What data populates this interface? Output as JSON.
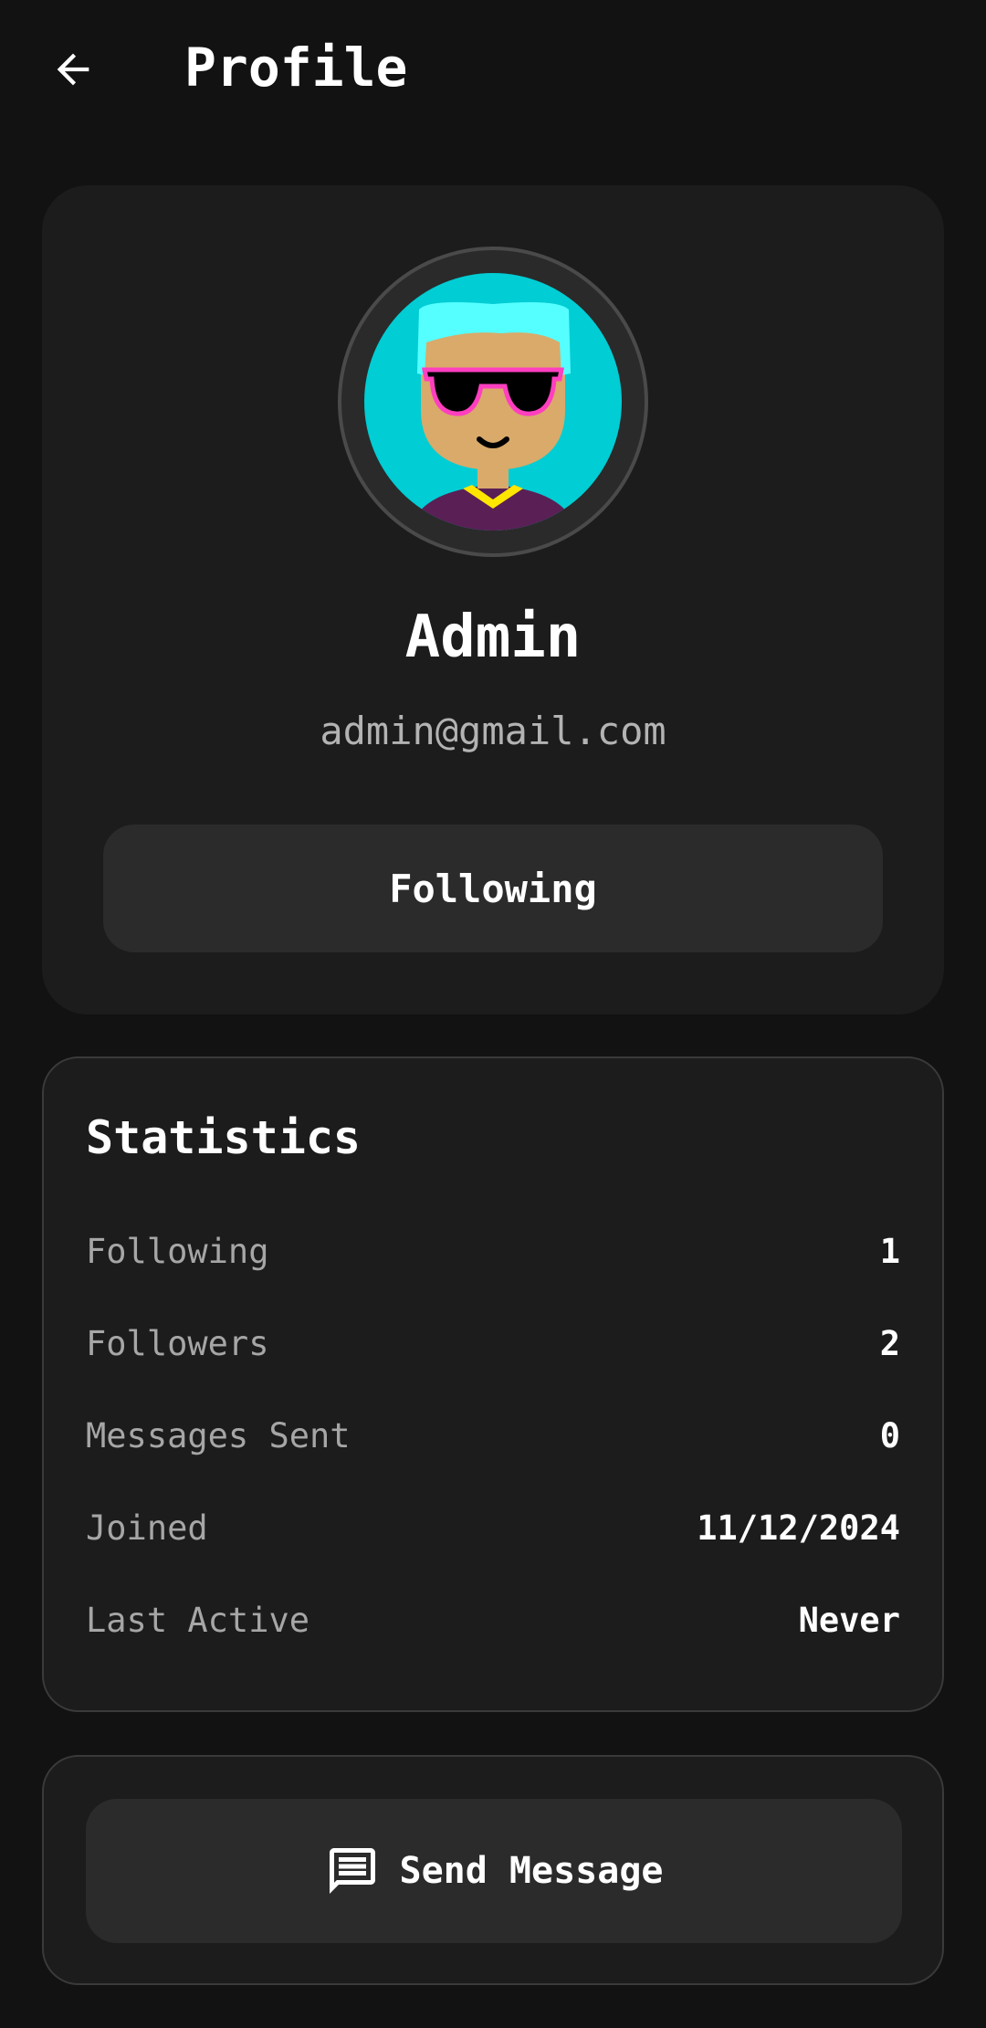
{
  "header": {
    "title": "Profile",
    "back_icon": "arrow-left-icon"
  },
  "profile": {
    "name": "Admin",
    "email": "admin@gmail.com",
    "follow_button_label": "Following",
    "avatar_icon": "avatar-cartoon-sunglasses"
  },
  "statistics": {
    "title": "Statistics",
    "rows": [
      {
        "label": "Following",
        "value": "1"
      },
      {
        "label": "Followers",
        "value": "2"
      },
      {
        "label": "Messages Sent",
        "value": "0"
      },
      {
        "label": "Joined",
        "value": "11/12/2024"
      },
      {
        "label": "Last Active",
        "value": "Never"
      }
    ]
  },
  "actions": {
    "send_message_label": "Send Message",
    "send_message_icon": "message-bubble-icon"
  },
  "colors": {
    "background": "#121212",
    "card": "#1c1c1c",
    "button": "#2b2b2b",
    "avatar_bg": "#00cdd4",
    "muted_text": "#a6a6a6"
  }
}
